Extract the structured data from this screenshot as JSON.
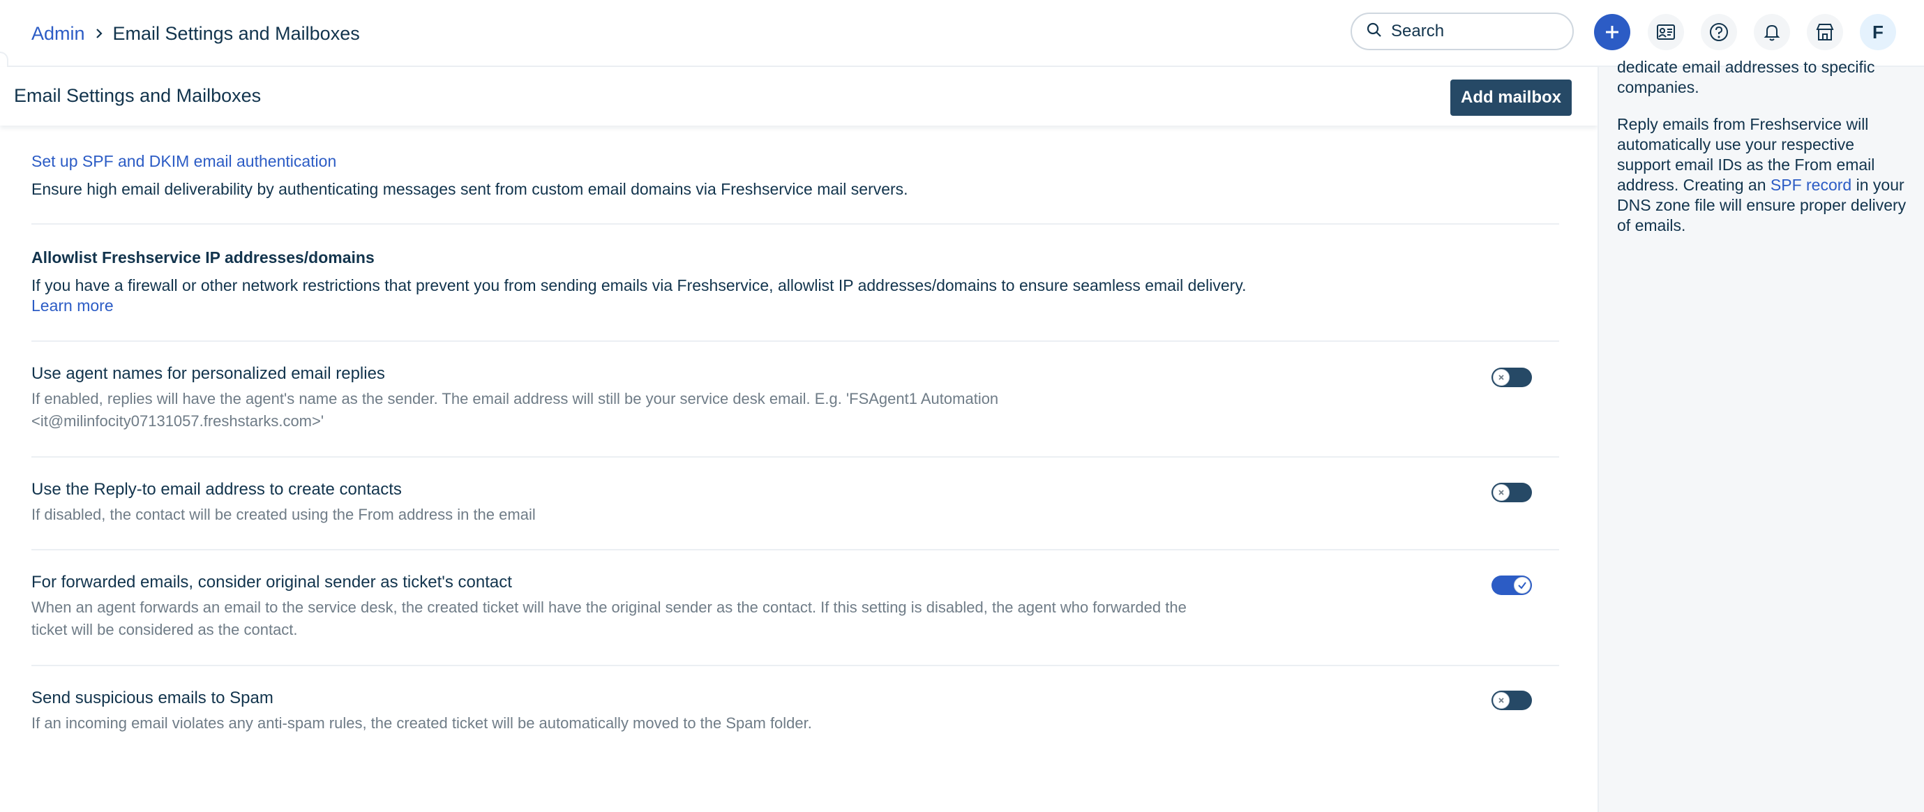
{
  "breadcrumb": {
    "parent": "Admin",
    "current": "Email Settings and Mailboxes"
  },
  "search": {
    "placeholder": "Search"
  },
  "avatar": {
    "initial": "F"
  },
  "header": {
    "title": "Email Settings and Mailboxes",
    "add_button": "Add mailbox"
  },
  "sections": {
    "spf": {
      "title": "Set up SPF and DKIM email authentication",
      "desc": "Ensure high email deliverability by authenticating messages sent from custom email domains via Freshservice mail servers."
    },
    "allowlist": {
      "title": "Allowlist Freshservice IP addresses/domains",
      "desc": "If you have a firewall or other network restrictions that prevent you from sending emails via Freshservice, allowlist IP addresses/domains to ensure seamless email delivery.",
      "link": "Learn more"
    }
  },
  "settings": [
    {
      "title": "Use agent names for personalized email replies",
      "desc_line1": "If enabled, replies will have the agent's name as the sender. The email address will still be your service desk email. E.g. 'FSAgent1 Automation",
      "desc_line2": "<it@milinfocity07131057.freshstarks.com>'",
      "enabled": false
    },
    {
      "title": "Use the Reply-to email address to create contacts",
      "desc_line1": "If disabled, the contact will be created using the From address in the email",
      "enabled": false
    },
    {
      "title": "For forwarded emails, consider original sender as ticket's contact",
      "desc_line1": "When an agent forwards an email to the service desk, the created ticket will have the original sender as the contact. If this setting is disabled, the agent who forwarded the",
      "desc_line2": "ticket will be considered as the contact.",
      "enabled": true
    },
    {
      "title": "Send suspicious emails to Spam",
      "desc_line1": "If an incoming email violates any anti-spam rules, the created ticket will be automatically moved to the Spam folder.",
      "enabled": false
    }
  ],
  "right_panel": {
    "para1_line1": "dedicate email addresses to specific",
    "para1_line2": "companies.",
    "para2_line1": "Reply emails from Freshservice will",
    "para2_line2": "automatically use your respective",
    "para2_line3": "support email IDs as the From email",
    "para2_line4_pre": "address. Creating an ",
    "para2_link": "SPF record",
    "para2_line4_post": " in your",
    "para2_line5": "DNS zone file will ensure proper delivery",
    "para2_line6": "of emails."
  },
  "colors": {
    "brand_blue": "#2c5cc5",
    "dark_navy": "#264966",
    "text": "#12344d",
    "muted": "#6f7c87"
  }
}
